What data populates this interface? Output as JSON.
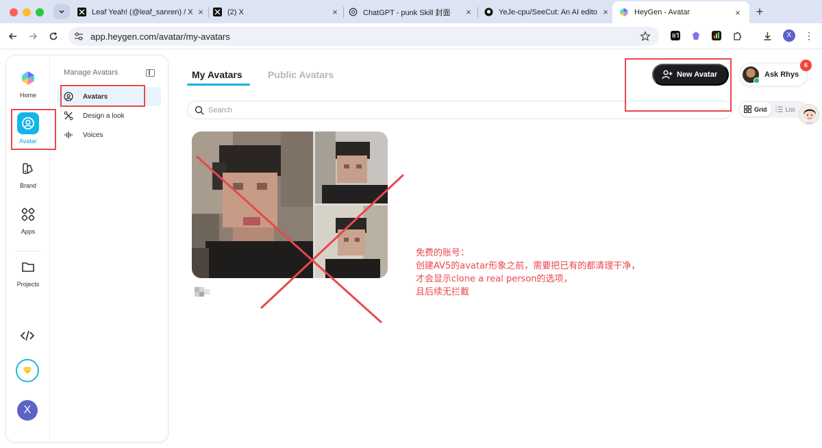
{
  "browser": {
    "tabs": [
      {
        "title": "Leaf Yeah! (@leaf_sanren) / X",
        "icon": "x-logo-icon"
      },
      {
        "title": "(2) X",
        "icon": "x-logo-icon"
      },
      {
        "title": "ChatGPT - punk Skill 封面",
        "icon": "chatgpt-icon"
      },
      {
        "title": "YeJe-cpu/SeeCut: An AI edito",
        "icon": "github-icon"
      },
      {
        "title": "HeyGen - Avatar",
        "icon": "heygen-logo-icon",
        "active": true
      }
    ],
    "url": "app.heygen.com/avatar/my-avatars",
    "profile_initial": "X"
  },
  "rail": {
    "items": [
      {
        "label": "Home",
        "icon": "heygen-logo-icon"
      },
      {
        "label": "Avatar",
        "icon": "avatar-icon",
        "active": true
      },
      {
        "label": "Brand",
        "icon": "brand-icon"
      },
      {
        "label": "Apps",
        "icon": "apps-icon"
      },
      {
        "label": "Projects",
        "icon": "folder-icon"
      }
    ],
    "user_initial": "X"
  },
  "submenu": {
    "header": "Manage Avatars",
    "items": [
      {
        "label": "Avatars",
        "icon": "avatar-icon",
        "active": true
      },
      {
        "label": "Design a look",
        "icon": "design-icon"
      },
      {
        "label": "Voices",
        "icon": "voice-wave-icon"
      }
    ]
  },
  "main": {
    "tabs": [
      {
        "label": "My Avatars",
        "active": true
      },
      {
        "label": "Public Avatars",
        "active": false
      }
    ],
    "new_avatar_label": "New Avatar",
    "ask_label": "Ask Rhys",
    "notification_count": "6",
    "search_placeholder": "Search",
    "view_grid": "Grid",
    "view_list": "List"
  },
  "annotation": {
    "lines": [
      "免费的账号：",
      "创建AV5的avatar形象之前，需要把已有的都清理干净，",
      "才会显示clone a real person的选项，",
      "且后续无拦截"
    ],
    "color": "#e8474d"
  },
  "colors": {
    "accent": "#12b1e4",
    "dark_button": "#1c1d21",
    "badge": "#f0463e"
  }
}
